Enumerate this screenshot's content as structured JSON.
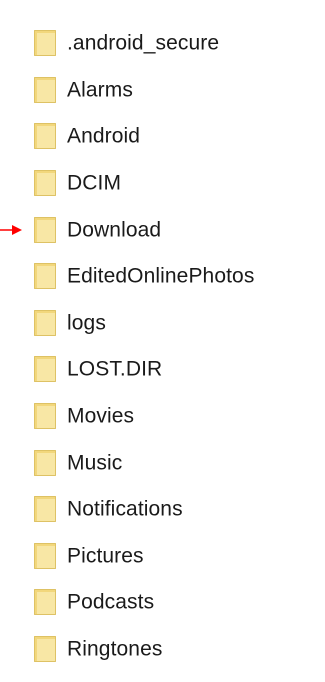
{
  "colors": {
    "folder_fill": "#f2d77c",
    "folder_fill_light": "#f8e7a5",
    "folder_edge": "#d7b84f",
    "pointer_arrow": "#ff0000"
  },
  "folders": [
    {
      "name": ".android_secure"
    },
    {
      "name": "Alarms"
    },
    {
      "name": "Android"
    },
    {
      "name": "DCIM"
    },
    {
      "name": "Download",
      "pointed": true
    },
    {
      "name": "EditedOnlinePhotos"
    },
    {
      "name": "logs"
    },
    {
      "name": "LOST.DIR"
    },
    {
      "name": "Movies"
    },
    {
      "name": "Music"
    },
    {
      "name": "Notifications"
    },
    {
      "name": "Pictures"
    },
    {
      "name": "Podcasts"
    },
    {
      "name": "Ringtones"
    }
  ],
  "icons": {
    "folder": "folder-icon",
    "pointer": "red-arrow-pointer-icon"
  }
}
